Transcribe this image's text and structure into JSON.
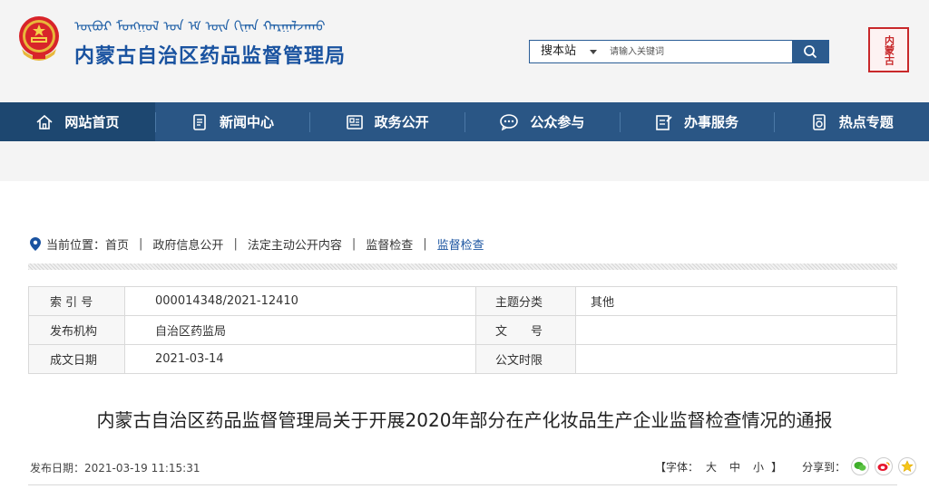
{
  "header": {
    "mongol_script": "ᠥᠪᠥᠷ ᠮᠣᠩᠭᠣᠯ ᠤᠨ ᠡᠮ ᠦᠨ ᠬᠢᠨᠠᠨ ᠬᠠᠷᠭᠠᠯᠵᠠᠬᠤ",
    "site_title": "内蒙古自治区药品监督管理局",
    "seal_text": "内蒙古",
    "emblem_icon": "national-emblem-icon"
  },
  "search": {
    "scope": "搜本站",
    "placeholder": "请输入关键词"
  },
  "nav": [
    {
      "label": "网站首页",
      "icon": "home-icon",
      "active": true
    },
    {
      "label": "新闻中心",
      "icon": "news-icon",
      "active": false
    },
    {
      "label": "政务公开",
      "icon": "government-icon",
      "active": false
    },
    {
      "label": "公众参与",
      "icon": "chat-icon",
      "active": false
    },
    {
      "label": "办事服务",
      "icon": "service-icon",
      "active": false
    },
    {
      "label": "热点专题",
      "icon": "topic-icon",
      "active": false
    }
  ],
  "breadcrumb": {
    "prefix": "当前位置：",
    "items": [
      "首页",
      "政府信息公开",
      "法定主动公开内容",
      "监督检查",
      "监督检查"
    ]
  },
  "info": {
    "index_label": "索 引 号",
    "index_value": "000014348/2021-12410",
    "topic_label": "主题分类",
    "topic_value": "其他",
    "publisher_label": "发布机构",
    "publisher_value": "自治区药监局",
    "doc_no_label": "文　　号",
    "doc_no_value": "",
    "created_label": "成文日期",
    "created_value": "2021-03-14",
    "published_label": "公文时限",
    "published_value": ""
  },
  "article": {
    "title": "内蒙古自治区药品监督管理局关于开展2020年部分在产化妆品生产企业监督检查情况的通报",
    "pubdate_label": "发布日期：",
    "pubdate_value": "2021-03-19 11:15:31",
    "font_label": "【字体：",
    "font_large": "大",
    "font_medium": "中",
    "font_small": "小",
    "font_close": "】",
    "share_label": "分享到："
  },
  "colors": {
    "nav_bg": "#2a5685",
    "nav_active": "#1d4770",
    "title_blue": "#1a53a0",
    "seal_red": "#c8282a"
  }
}
